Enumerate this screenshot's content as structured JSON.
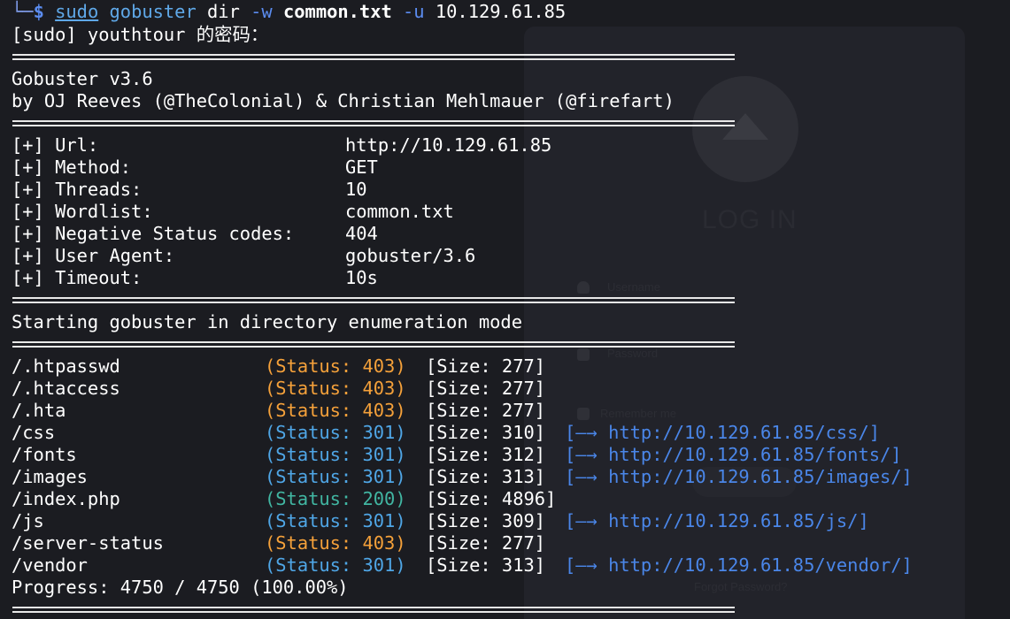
{
  "colors": {
    "background": "#1b1c21",
    "status_403": "#f5a13a",
    "status_301": "#4fa6e6",
    "status_200": "#41b6a2",
    "redirect": "#4a86e8",
    "prompt": "#5b8cf0"
  },
  "prompt": {
    "corner": "└─",
    "dollar": "$",
    "sudo": "sudo",
    "tool": "gobuster",
    "subcommand": "dir",
    "flag_w": "-w",
    "wordlist": "common.txt",
    "flag_u": "-u",
    "target": "10.129.61.85"
  },
  "sudo_prompt": "[sudo] youthtour 的密码：",
  "banner": {
    "title": "Gobuster v3.6",
    "credits": "by OJ Reeves (@TheColonial) & Christian Mehlmauer (@firefart)"
  },
  "config": [
    {
      "label": "[+] Url:",
      "value": "http://10.129.61.85"
    },
    {
      "label": "[+] Method:",
      "value": "GET"
    },
    {
      "label": "[+] Threads:",
      "value": "10"
    },
    {
      "label": "[+] Wordlist:",
      "value": "common.txt"
    },
    {
      "label": "[+] Negative Status codes:",
      "value": "404"
    },
    {
      "label": "[+] User Agent:",
      "value": "gobuster/3.6"
    },
    {
      "label": "[+] Timeout:",
      "value": "10s"
    }
  ],
  "mode_message": "Starting gobuster in directory enumeration mode",
  "results": [
    {
      "path": "/.htpasswd",
      "status": "(Status: 403)",
      "code": 403,
      "size": "[Size: 277]",
      "redirect": ""
    },
    {
      "path": "/.htaccess",
      "status": "(Status: 403)",
      "code": 403,
      "size": "[Size: 277]",
      "redirect": ""
    },
    {
      "path": "/.hta",
      "status": "(Status: 403)",
      "code": 403,
      "size": "[Size: 277]",
      "redirect": ""
    },
    {
      "path": "/css",
      "status": "(Status: 301)",
      "code": 301,
      "size": "[Size: 310]",
      "redirect": "[–→ http://10.129.61.85/css/]"
    },
    {
      "path": "/fonts",
      "status": "(Status: 301)",
      "code": 301,
      "size": "[Size: 312]",
      "redirect": "[–→ http://10.129.61.85/fonts/]"
    },
    {
      "path": "/images",
      "status": "(Status: 301)",
      "code": 301,
      "size": "[Size: 313]",
      "redirect": "[–→ http://10.129.61.85/images/]"
    },
    {
      "path": "/index.php",
      "status": "(Status: 200)",
      "code": 200,
      "size": "[Size: 4896]",
      "redirect": ""
    },
    {
      "path": "/js",
      "status": "(Status: 301)",
      "code": 301,
      "size": "[Size: 309]",
      "redirect": "[–→ http://10.129.61.85/js/]"
    },
    {
      "path": "/server-status",
      "status": "(Status: 403)",
      "code": 403,
      "size": "[Size: 277]",
      "redirect": ""
    },
    {
      "path": "/vendor",
      "status": "(Status: 301)",
      "code": 301,
      "size": "[Size: 313]",
      "redirect": "[–→ http://10.129.61.85/vendor/]"
    }
  ],
  "progress": {
    "text": "Progress: 4750 / 4750 (100.00%)",
    "fraction": 1.0
  },
  "background_page": {
    "title": "LOG IN",
    "username_placeholder": "Username",
    "password_placeholder": "Password",
    "remember_label": "Remember me",
    "forgot_link": "Forgot Password?"
  }
}
